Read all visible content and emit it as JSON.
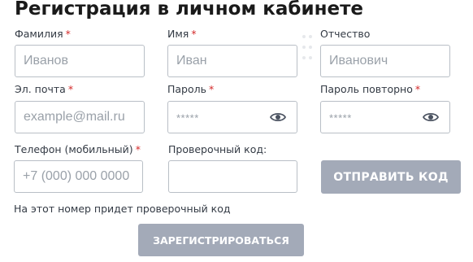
{
  "form": {
    "title": "Регистрация в личном кабинете",
    "required_mark": "*",
    "fields": {
      "last_name": {
        "label": "Фамилия",
        "placeholder": "Иванов",
        "required": true
      },
      "first_name": {
        "label": "Имя",
        "placeholder": "Иван",
        "required": true
      },
      "middle_name": {
        "label": "Отчество",
        "placeholder": "Иванович",
        "required": false
      },
      "email": {
        "label": "Эл. почта",
        "placeholder": "example@mail.ru",
        "required": true
      },
      "password": {
        "label": "Пароль",
        "placeholder": "*****",
        "required": true
      },
      "password_repeat": {
        "label": "Пароль повторно",
        "placeholder": "*****",
        "required": true
      },
      "phone": {
        "label": "Телефон (мобильный)",
        "placeholder": "+7 (000) 000 0000",
        "required": true
      },
      "code": {
        "label": "Проверочный код:",
        "placeholder": "",
        "required": false
      }
    },
    "send_code_button": "ОТПРАВИТЬ КОД",
    "phone_hint": "На этот номер придет проверочный код",
    "register_button": "ЗАРЕГИСТРИРОВАТЬСЯ",
    "icons": {
      "password_toggle": "eye-icon",
      "drag_handle": "drag-dots-icon"
    },
    "colors": {
      "required": "#d42a2a",
      "button_bg": "#a3aab8",
      "button_text": "#ffffff",
      "input_border": "#b9bfc6"
    }
  }
}
